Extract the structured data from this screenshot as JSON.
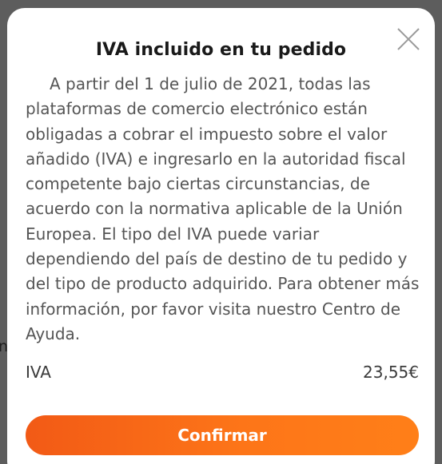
{
  "backdrop": {
    "peek_text": "n"
  },
  "modal": {
    "title": "IVA incluido en tu pedido",
    "close_icon": "close-icon",
    "body": "A partir del 1 de julio de 2021, todas las plataformas de comercio electrónico están obligadas a cobrar el impuesto sobre el valor añadido (IVA) e ingresarlo en la autoridad fiscal competente bajo ciertas circunstancias, de acuerdo con la normativa aplicable de la Unión Europea. El tipo del IVA puede variar dependiendo del país de destino de tu pedido y del tipo de producto adquirido. Para obtener más información, por favor visita nuestro Centro de Ayuda.",
    "iva_label": "IVA",
    "iva_value": "23,55€",
    "confirm_label": "Confirmar"
  },
  "colors": {
    "accent": "#fd7518",
    "accent_start": "#f25a16",
    "overlay": "#5d5d5d",
    "text_muted": "#555555",
    "title": "#1a1a1a"
  }
}
